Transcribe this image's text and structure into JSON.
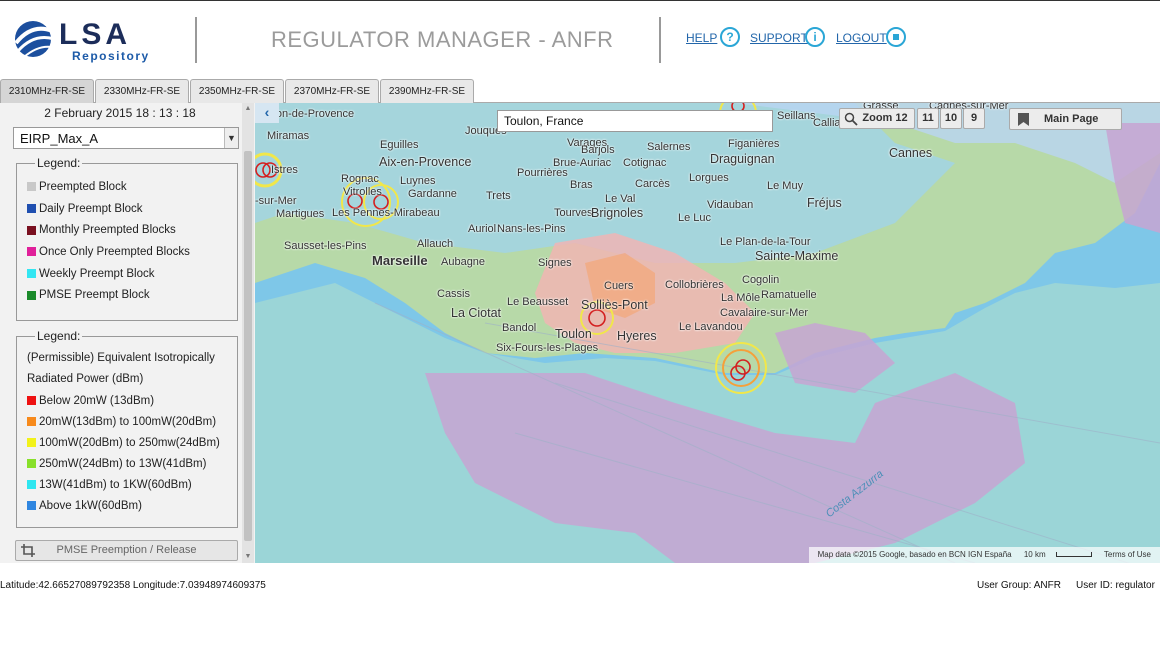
{
  "header": {
    "logo_text": "LSA",
    "logo_sub": "Repository",
    "title": "REGULATOR MANAGER - ANFR",
    "links": {
      "help": "HELP",
      "support": "SUPPORT",
      "logout": "LOGOUT"
    },
    "help_icon": "?",
    "support_icon": "i"
  },
  "tabs": [
    "2310MHz-FR-SE",
    "2330MHz-FR-SE",
    "2350MHz-FR-SE",
    "2370MHz-FR-SE",
    "2390MHz-FR-SE"
  ],
  "active_tab": 0,
  "sidebar": {
    "datetime": "2 February 2015 18 : 13 : 18",
    "layer_select": "EIRP_Max_A",
    "legend1": {
      "title": "Legend:",
      "items": [
        {
          "label": "Preempted Block",
          "color": "#c8c8c8"
        },
        {
          "label": "Daily Preempt Block",
          "color": "#1f4fb0"
        },
        {
          "label": "Monthly Preempted Blocks",
          "color": "#7a1020"
        },
        {
          "label": "Once Only Preempted Blocks",
          "color": "#e0209a"
        },
        {
          "label": "Weekly Preempt Block",
          "color": "#33e6f2"
        },
        {
          "label": "PMSE Preempt Block",
          "color": "#1a8a2a"
        }
      ]
    },
    "legend2": {
      "title": "Legend:",
      "description_line1": "(Permissible) Equivalent Isotropically",
      "description_line2": "Radiated Power (dBm)",
      "items": [
        {
          "label": "Below 20mW (13dBm)",
          "color": "#ee1111"
        },
        {
          "label": "20mW(13dBm) to 100mW(20dBm)",
          "color": "#f78a1c"
        },
        {
          "label": "100mW(20dBm) to 250mw(24dBm)",
          "color": "#f2f21a"
        },
        {
          "label": "250mW(24dBm) to 13W(41dBm)",
          "color": "#88e02a"
        },
        {
          "label": "13W(41dBm) to 1KW(60dBm)",
          "color": "#2ee6f0"
        },
        {
          "label": "Above 1kW(60dBm)",
          "color": "#2f86e0"
        }
      ]
    },
    "pmse_button": "PMSE Preemption / Release"
  },
  "map": {
    "search_value": "Toulon, France",
    "zoom": {
      "label": "Zoom 12",
      "levels": [
        "11",
        "10",
        "9"
      ]
    },
    "main_page": "Main Page",
    "attribution": {
      "data": "Map data ©2015 Google, basado en BCN IGN España",
      "scale": "10 km",
      "terms": "Terms of Use"
    },
    "places": [
      "Salon-de-Provence",
      "Jouques",
      "Seillans",
      "Grasse",
      "Cagnes-sur-Mer",
      "Callian",
      "Miramas",
      "Eguilles",
      "Varages",
      "Barjols",
      "Figanières",
      "Aix-en-Provence",
      "Salernes",
      "Draguignan",
      "Cannes",
      "Brue-Auriac",
      "Cotignac",
      "Istres",
      "Rognac",
      "Luynes",
      "Pourrières",
      "Lorgues",
      "Vitrolles",
      "Bras",
      "Carcès",
      "Le Muy",
      "-sur-Mer",
      "Gardanne",
      "Trets",
      "Le Val",
      "Fréjus",
      "Martigues",
      "Les Pennes-Mirabeau",
      "Tourves",
      "Brignoles",
      "Vidauban",
      "Auriol",
      "Nans-les-Pins",
      "Le Luc",
      "Sausset-les-Pins",
      "Allauch",
      "Le Plan-de-la-Tour",
      "Sainte-Maxime",
      "Marseille",
      "Aubagne",
      "Signes",
      "Cuers",
      "Collobrières",
      "Cogolin",
      "Cassis",
      "Le Beausset",
      "Solliès-Pont",
      "La Môle",
      "Ramatuelle",
      "La Ciotat",
      "Cavalaire-sur-Mer",
      "Bandol",
      "Toulon",
      "Hyeres",
      "Le Lavandou",
      "Six-Fours-les-Plages",
      "Costa Azzurra"
    ]
  },
  "footer": {
    "coordinates": "Latitude:42.66527089792358 Longitude:7.03948974609375",
    "user_group": "User Group: ANFR",
    "user_id": "User ID: regulator"
  }
}
